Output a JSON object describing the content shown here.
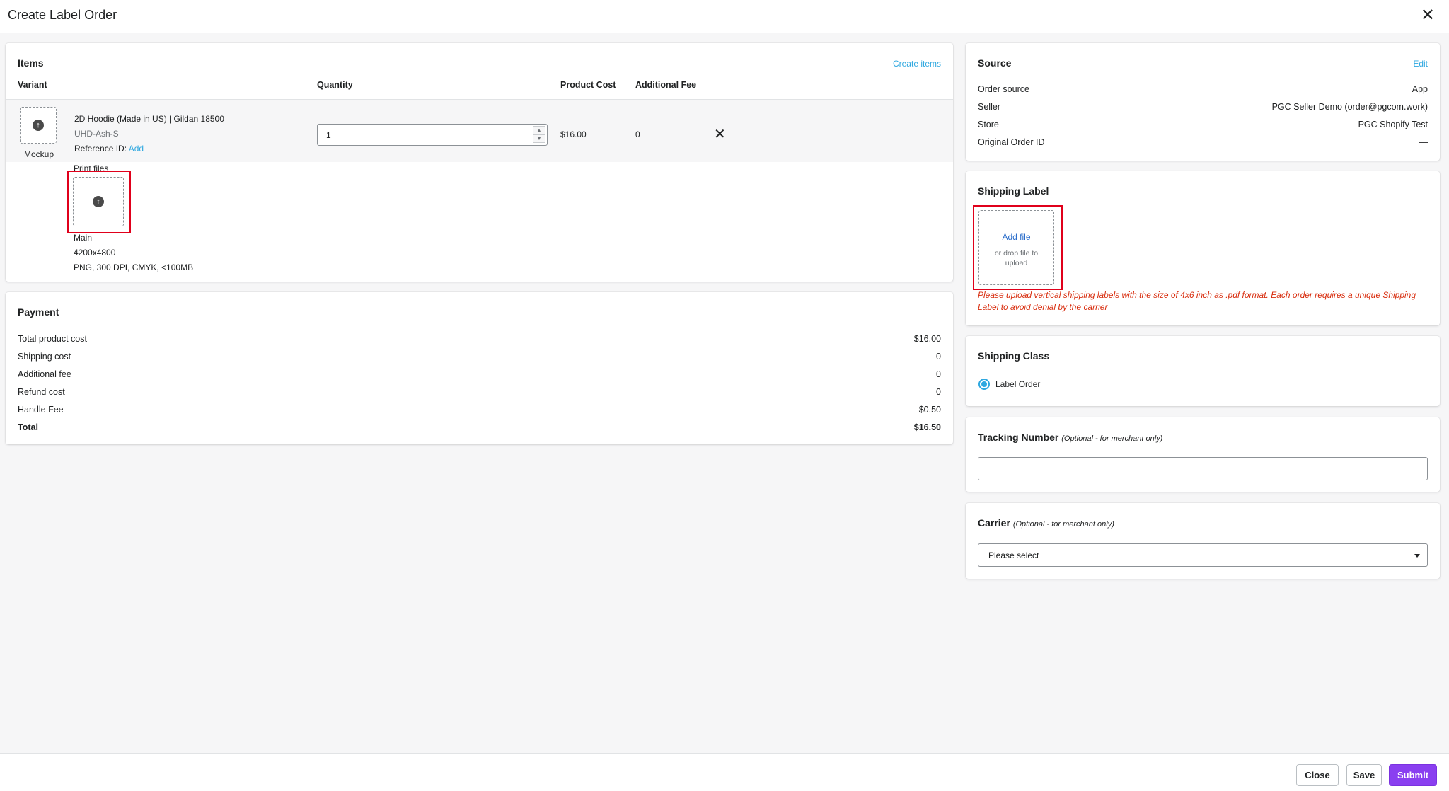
{
  "modal": {
    "title": "Create Label Order"
  },
  "items": {
    "title": "Items",
    "create_link": "Create items",
    "columns": {
      "variant": "Variant",
      "quantity": "Quantity",
      "product_cost": "Product Cost",
      "additional_fee": "Additional Fee"
    },
    "row": {
      "mockup_label": "Mockup",
      "name": "2D Hoodie (Made in US) | Gildan 18500",
      "sku": "UHD-Ash-S",
      "reference_label": "Reference ID:",
      "reference_link": "Add",
      "quantity": "1",
      "product_cost": "$16.00",
      "additional_fee": "0"
    },
    "print_files": {
      "label": "Print files",
      "name": "Main",
      "size": "4200x4800",
      "spec": "PNG, 300 DPI, CMYK, <100MB"
    }
  },
  "payment": {
    "title": "Payment",
    "rows": [
      {
        "label": "Total product cost",
        "value": "$16.00"
      },
      {
        "label": "Shipping cost",
        "value": "0"
      },
      {
        "label": "Additional fee",
        "value": "0"
      },
      {
        "label": "Refund cost",
        "value": "0"
      },
      {
        "label": "Handle Fee",
        "value": "$0.50"
      },
      {
        "label": "Total",
        "value": "$16.50"
      }
    ]
  },
  "source": {
    "title": "Source",
    "edit": "Edit",
    "rows": [
      {
        "label": "Order source",
        "value": "App"
      },
      {
        "label": "Seller",
        "value": "PGC Seller Demo (order@pgcom.work)"
      },
      {
        "label": "Store",
        "value": "PGC Shopify Test"
      },
      {
        "label": "Original Order ID",
        "value": "—"
      }
    ]
  },
  "shipping_label": {
    "title": "Shipping Label",
    "add_file": "Add file",
    "drop_text": "or drop file to upload",
    "warning": "Please upload vertical shipping labels with the size of 4x6 inch as .pdf format. Each order requires a unique Shipping Label to avoid denial by the carrier"
  },
  "shipping_class": {
    "title": "Shipping Class",
    "option": "Label Order"
  },
  "tracking": {
    "title": "Tracking Number",
    "optional": "(Optional - for merchant only)",
    "value": ""
  },
  "carrier": {
    "title": "Carrier",
    "optional": "(Optional - for merchant only)",
    "selected": "Please select"
  },
  "footer": {
    "close": "Close",
    "save": "Save",
    "submit": "Submit"
  },
  "colors": {
    "accent": "#8a3ff0",
    "link": "#2fa8e0",
    "warning": "#d82c0d",
    "highlight": "#e0001b"
  }
}
